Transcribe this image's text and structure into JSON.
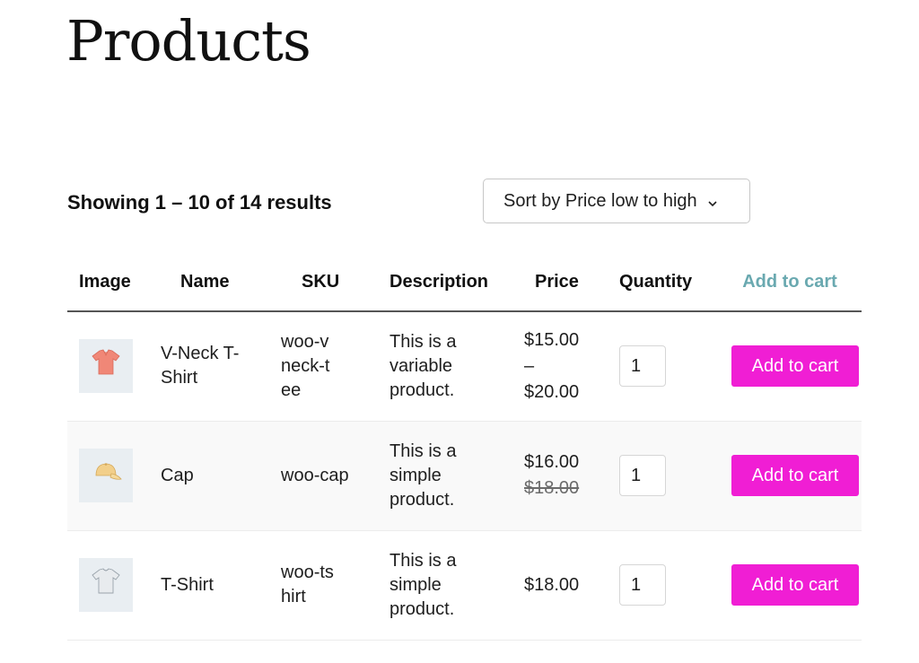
{
  "page": {
    "title": "Products"
  },
  "toolbar": {
    "results_text": "Showing 1 – 10 of 14 results",
    "sort_label": "Sort by Price low to high"
  },
  "table": {
    "headers": [
      "Image",
      "Name",
      "SKU",
      "Description",
      "Price",
      "Quantity",
      "Add to cart"
    ],
    "rows": [
      {
        "name": "V-Neck T-Shirt",
        "sku": "woo-vneck-tee",
        "description": "This is a variable product.",
        "price": "$15.00 – $20.00",
        "price_line1": "$15.00",
        "price_sep": "–",
        "price_line2": "$20.00",
        "quantity": "1",
        "button": "Add to cart",
        "image_icon": "vneck-tshirt-icon"
      },
      {
        "name": "Cap",
        "sku": "woo-cap",
        "description": "This is a simple product.",
        "price": "$16.00",
        "regular_price": "$18.00",
        "quantity": "1",
        "button": "Add to cart",
        "image_icon": "cap-icon"
      },
      {
        "name": "T-Shirt",
        "sku": "woo-tshirt",
        "description": "This is a simple product.",
        "price": "$18.00",
        "quantity": "1",
        "button": "Add to cart",
        "image_icon": "tshirt-icon"
      }
    ]
  },
  "colors": {
    "button_bg": "#f01ed4",
    "button_text": "#ffffff",
    "add_to_cart_header": "#6aa9b0",
    "image_bg": "#e9eef2"
  }
}
